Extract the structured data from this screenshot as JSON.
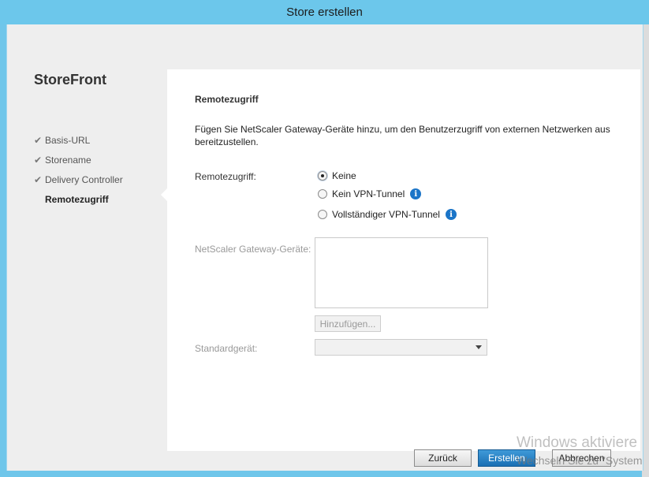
{
  "window": {
    "title": "Store erstellen"
  },
  "sidebar": {
    "brand": "StoreFront",
    "steps": [
      {
        "label": "Basis-URL",
        "done": true
      },
      {
        "label": "Storename",
        "done": true
      },
      {
        "label": "Delivery Controller",
        "done": true
      },
      {
        "label": "Remotezugriff",
        "done": false,
        "active": true
      }
    ],
    "check_glyph": "✔"
  },
  "main": {
    "section_title": "Remotezugriff",
    "description": "Fügen Sie NetScaler Gateway-Geräte hinzu, um den Benutzerzugriff von externen Netzwerken aus bereitzustellen.",
    "remote_access_label": "Remotezugriff:",
    "options": [
      {
        "label": "Keine",
        "checked": true,
        "info": false
      },
      {
        "label": "Kein VPN-Tunnel",
        "checked": false,
        "info": true
      },
      {
        "label": "Vollständiger VPN-Tunnel",
        "checked": false,
        "info": true
      }
    ],
    "info_glyph": "i",
    "gateway_label": "NetScaler Gateway-Geräte:",
    "add_button": "Hinzufügen...",
    "default_device_label": "Standardgerät:",
    "default_device_value": ""
  },
  "footer": {
    "back": "Zurück",
    "create": "Erstellen",
    "cancel": "Abbrechen"
  },
  "watermark": {
    "line1": "Windows aktiviere",
    "line2": "Wechseln Sie zu \"System"
  },
  "colors": {
    "titlebar": "#6cc7eb",
    "primary_button": "#1a6fb3",
    "info_icon": "#1b75c8"
  }
}
